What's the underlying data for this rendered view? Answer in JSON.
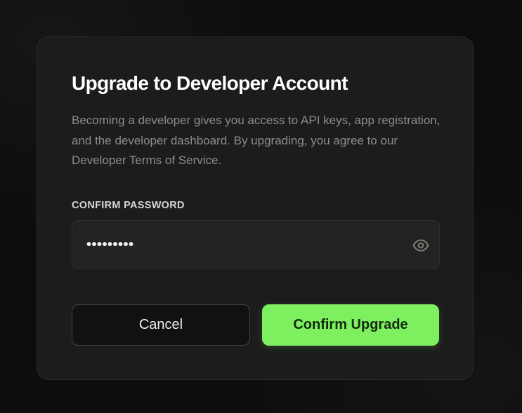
{
  "dialog": {
    "title": "Upgrade to Developer Account",
    "description": "Becoming a developer gives you access to API keys, app registration, and the developer dashboard. By upgrading, you agree to our Developer Terms of Service.",
    "password_label": "CONFIRM PASSWORD",
    "password_value": "•••••••••",
    "cancel_label": "Cancel",
    "confirm_label": "Confirm Upgrade"
  },
  "icons": {
    "password_toggle": "eye-icon"
  },
  "colors": {
    "accent": "#7ef05f",
    "background": "#0d0d0d",
    "card": "#1c1c1c",
    "muted_text": "#8a8f88"
  }
}
